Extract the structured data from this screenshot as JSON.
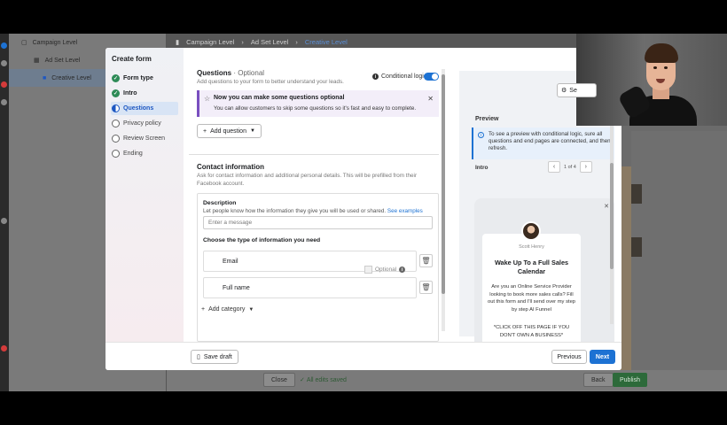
{
  "background": {
    "tree": {
      "campaign": "Campaign Level",
      "adset": "Ad Set Level",
      "creative": "Creative Level"
    },
    "breadcrumb": [
      "Campaign Level",
      "Ad Set Level",
      "Creative Level"
    ],
    "footer": {
      "close": "Close",
      "status": "All edits saved",
      "back": "Back",
      "publish": "Publish"
    }
  },
  "modal": {
    "sidebar": {
      "title": "Create form",
      "steps": [
        {
          "label": "Form type",
          "state": "done"
        },
        {
          "label": "Intro",
          "state": "done"
        },
        {
          "label": "Questions",
          "state": "current"
        },
        {
          "label": "Privacy policy",
          "state": "todo"
        },
        {
          "label": "Review Screen",
          "state": "todo"
        },
        {
          "label": "Ending",
          "state": "todo"
        }
      ]
    },
    "questions": {
      "title": "Questions",
      "title_suffix": "· Optional",
      "subtitle": "Add questions to your form to better understand your leads.",
      "conditional_logic": "Conditional logic",
      "conditional_logic_on": true,
      "notice": {
        "title": "Now you can make some questions optional",
        "desc": "You can allow customers to skip some questions so it's fast and easy to complete."
      },
      "add_question": "Add question"
    },
    "contact": {
      "title": "Contact information",
      "subtitle_1": "Ask for contact information and additional personal details. This will be prefilled from their",
      "subtitle_2": "Facebook account.",
      "description_label": "Description",
      "description_help": "Let people know how the information they give you will be used or shared.",
      "see_examples": "See examples",
      "message_placeholder": "Enter a message",
      "choose_label": "Choose the type of information you need",
      "fields": [
        {
          "label": "Email",
          "optional_label": "Optional"
        },
        {
          "label": "Full name"
        }
      ],
      "add_category": "Add category"
    },
    "preview": {
      "settings": "Se",
      "title": "Preview",
      "info": "To see a preview with conditional logic, sure all questions and end pages are connected, and then refresh.",
      "section": "Intro",
      "page": "1 of 4",
      "card": {
        "name": "Scott Henry",
        "headline": "Wake Up To a Full Sales Calendar",
        "body": "Are you an Online Service Provider looking to book more sales calls? Fill out this form and I'll send over my step by step AI Funnel",
        "cta": "*CLICK OFF THIS PAGE IF YOU DON'T OWN A BUSINESS*"
      }
    },
    "footer": {
      "save_draft": "Save draft",
      "previous": "Previous",
      "next": "Next"
    }
  },
  "colors": {
    "accent": "#1d72d3",
    "success": "#2e8b57",
    "notice_border": "#7a4fc0"
  }
}
